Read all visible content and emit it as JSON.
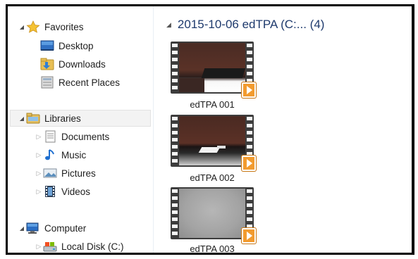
{
  "nav": {
    "favorites": {
      "label": "Favorites",
      "items": [
        {
          "label": "Desktop"
        },
        {
          "label": "Downloads"
        },
        {
          "label": "Recent Places"
        }
      ]
    },
    "libraries": {
      "label": "Libraries",
      "items": [
        {
          "label": "Documents"
        },
        {
          "label": "Music"
        },
        {
          "label": "Pictures"
        },
        {
          "label": "Videos"
        }
      ]
    },
    "computer": {
      "label": "Computer",
      "items": [
        {
          "label": "Local Disk (C:)"
        }
      ]
    }
  },
  "content": {
    "group_title": "2015-10-06 edTPA (C:... (4)",
    "files": [
      {
        "name": "edTPA 001",
        "icon": "video-thumbnail"
      },
      {
        "name": "edTPA 002",
        "icon": "video-thumbnail"
      },
      {
        "name": "edTPA 003",
        "icon": "video-thumbnail"
      }
    ]
  },
  "colors": {
    "group_title": "#1e3a6d",
    "selected_bg": "#f3f3f3",
    "play_badge": "#f29b2f"
  }
}
